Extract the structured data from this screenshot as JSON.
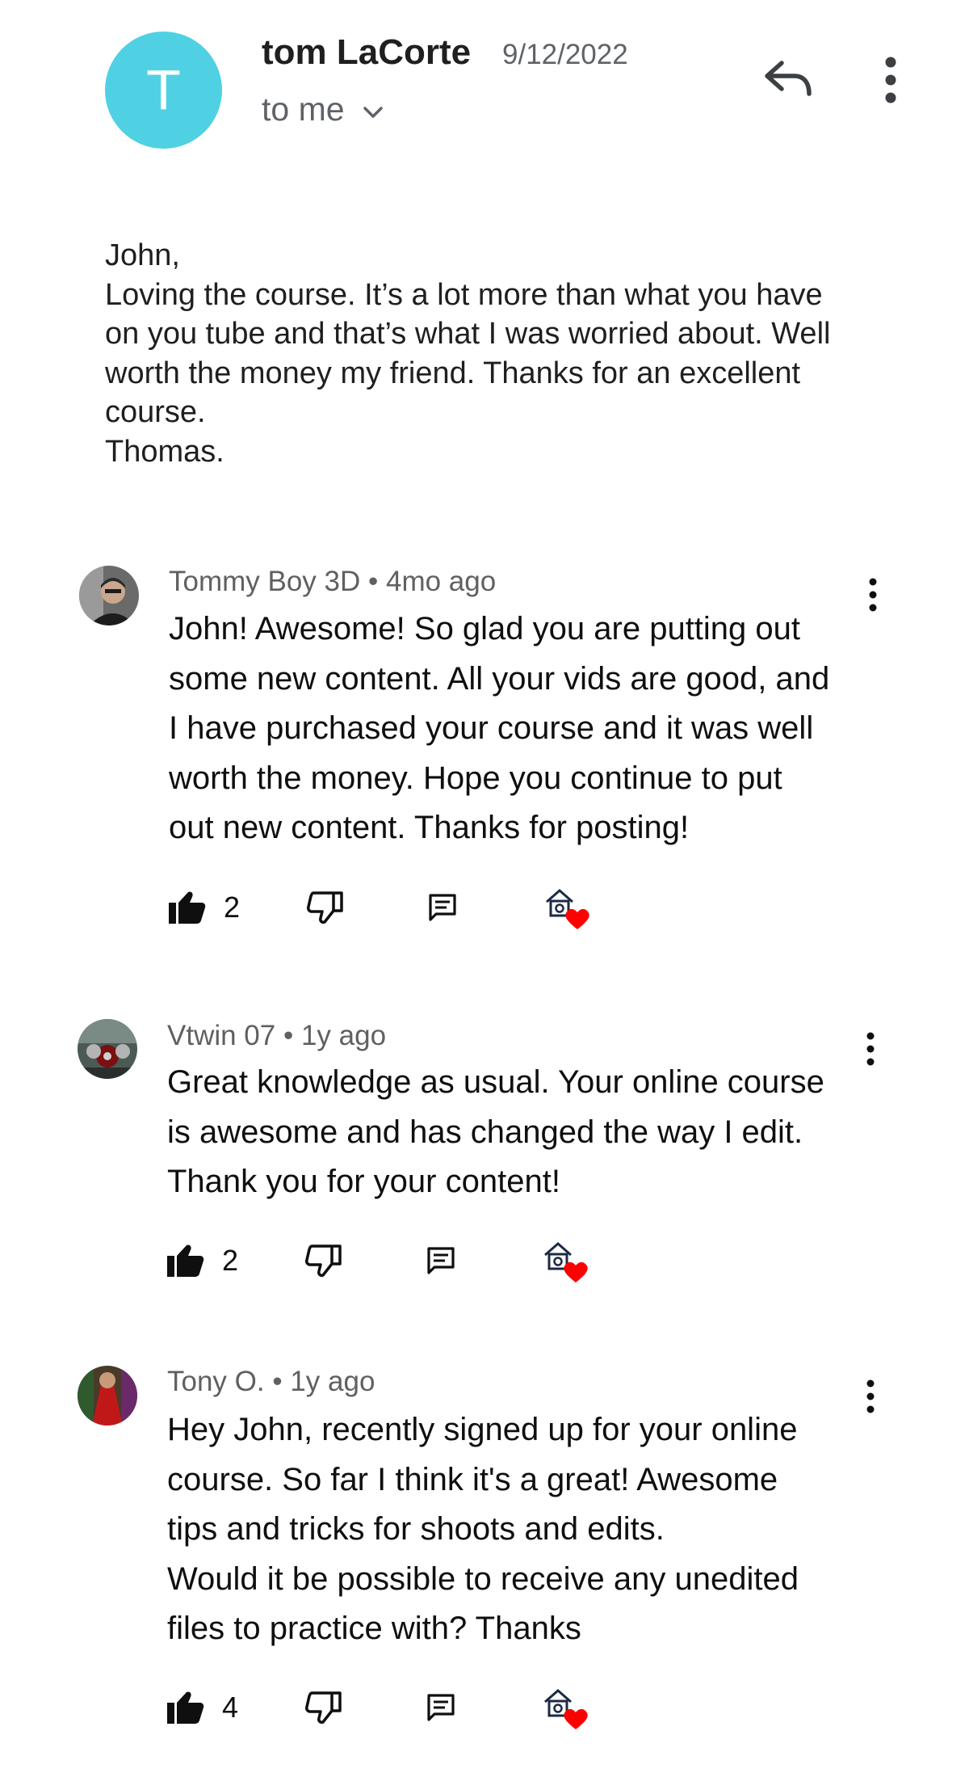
{
  "email": {
    "sender_initial": "T",
    "sender_name": "tom LaCorte",
    "date": "9/12/2022",
    "recipient": "to me",
    "avatar_color": "#4fd1e3",
    "body_lines": [
      "John,",
      "Loving the course. It’s a lot more than what you have",
      "on you tube and that’s what I was worried about. Well",
      "worth the money my friend. Thanks for an excellent",
      "course.",
      "Thomas."
    ]
  },
  "icons": {
    "reply": "reply-icon",
    "more": "more-vert-icon",
    "chevron": "chevron-down-icon",
    "like": "thumb-up-icon",
    "dislike": "thumb-down-icon",
    "reply_comment": "comment-icon",
    "heart": "creator-heart-icon"
  },
  "comments": [
    {
      "author": "Tommy Boy 3D",
      "time": "4mo ago",
      "lines": [
        "John! Awesome! So glad you are putting out",
        "some new content. All your vids are good, and",
        "I have purchased your course and it was well",
        "worth the money. Hope you continue to put",
        "out new content. Thanks for posting!"
      ],
      "likes": "2"
    },
    {
      "author": "Vtwin 07",
      "time": "1y ago",
      "lines": [
        "Great knowledge as usual. Your online course",
        "is awesome and has changed the way I edit.",
        "Thank you for your content!"
      ],
      "likes": "2"
    },
    {
      "author": "Tony O.",
      "time": "1y ago",
      "lines": [
        "Hey John, recently signed up for your online",
        "course. So far I think it's a great! Awesome",
        "tips and tricks for shoots and edits.",
        "Would it be possible to receive any unedited",
        "files to practice with? Thanks"
      ],
      "likes": "4"
    }
  ]
}
